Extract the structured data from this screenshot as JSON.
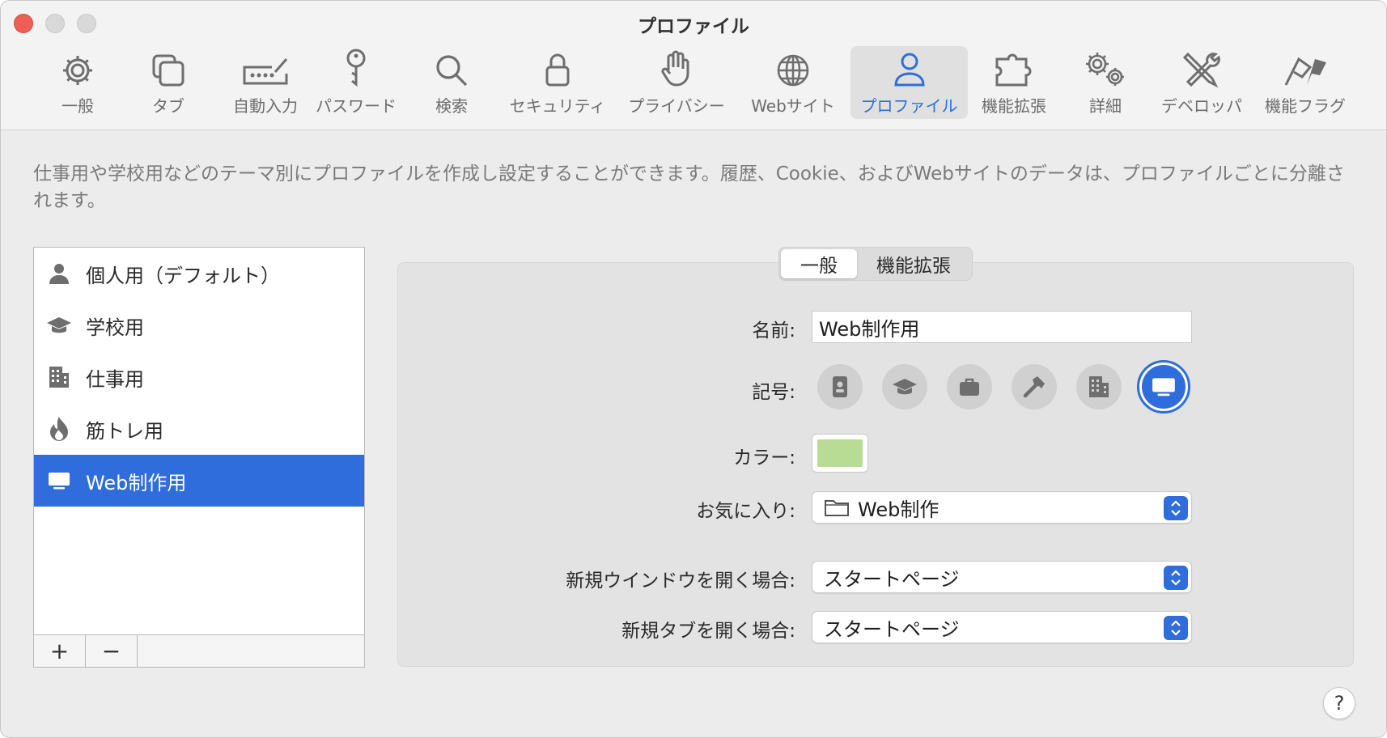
{
  "window": {
    "title": "プロファイル"
  },
  "toolbar": {
    "tabs": [
      {
        "label": "一般",
        "icon": "gear-icon"
      },
      {
        "label": "タブ",
        "icon": "tabs-icon"
      },
      {
        "label": "自動入力",
        "icon": "autofill-icon"
      },
      {
        "label": "パスワード",
        "icon": "key-icon"
      },
      {
        "label": "検索",
        "icon": "search-icon"
      },
      {
        "label": "セキュリティ",
        "icon": "lock-icon"
      },
      {
        "label": "プライバシー",
        "icon": "hand-icon"
      },
      {
        "label": "Webサイト",
        "icon": "globe-icon"
      },
      {
        "label": "プロファイル",
        "icon": "person-icon"
      },
      {
        "label": "機能拡張",
        "icon": "puzzle-icon"
      },
      {
        "label": "詳細",
        "icon": "gears-icon"
      },
      {
        "label": "デベロッパ",
        "icon": "tools-icon"
      },
      {
        "label": "機能フラグ",
        "icon": "flags-icon"
      }
    ],
    "active_tab": "プロファイル"
  },
  "description": "仕事用や学校用などのテーマ別にプロファイルを作成し設定することができます。履歴、Cookie、およびWebサイトのデータは、プロファイルごとに分離されます。",
  "profiles": {
    "items": [
      {
        "label": "個人用（デフォルト）",
        "icon": "person-icon"
      },
      {
        "label": "学校用",
        "icon": "graduation-cap-icon"
      },
      {
        "label": "仕事用",
        "icon": "building-icon"
      },
      {
        "label": "筋トレ用",
        "icon": "flame-icon"
      },
      {
        "label": "Web制作用",
        "icon": "monitor-icon"
      }
    ],
    "selected": "Web制作用",
    "add_label": "+",
    "remove_label": "−"
  },
  "detail": {
    "segments": [
      "一般",
      "機能拡張"
    ],
    "active_segment": "一般",
    "name_label": "名前:",
    "name_value": "Web制作用",
    "symbol_label": "記号:",
    "symbols": [
      "id-badge-icon",
      "graduation-cap-icon",
      "briefcase-icon",
      "hammer-icon",
      "building-icon",
      "monitor-icon"
    ],
    "selected_symbol": "monitor-icon",
    "color_label": "カラー:",
    "color_value": "#b9dc94",
    "favorites_label": "お気に入り:",
    "favorites_value": "Web制作",
    "new_window_label": "新規ウインドウを開く場合:",
    "new_window_value": "スタートページ",
    "new_tab_label": "新規タブを開く場合:",
    "new_tab_value": "スタートページ"
  },
  "help_label": "?",
  "colors": {
    "accent": "#2f6ddc",
    "close": "#ec5f57"
  }
}
